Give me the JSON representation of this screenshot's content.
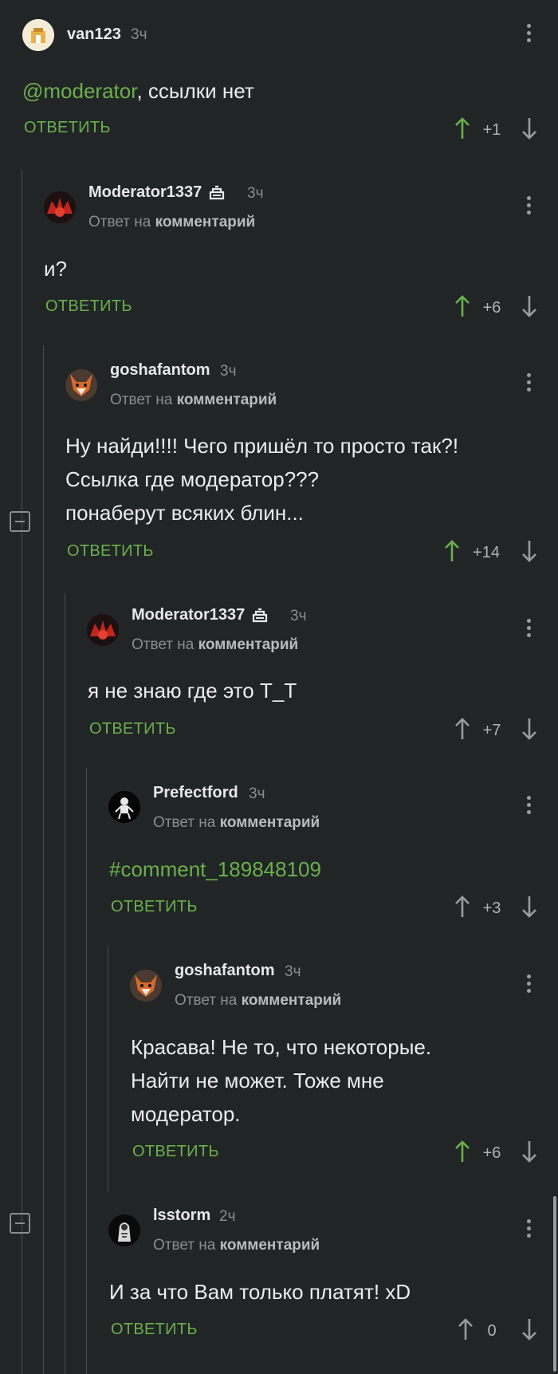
{
  "labels": {
    "reply_to_prefix": "Ответ на",
    "reply_to_target": "комментарий",
    "reply_button": "ОТВЕТИТЬ"
  },
  "colors": {
    "background": "#222526",
    "accent_green": "#6ab04c",
    "muted": "#8a8d8f"
  },
  "comments": [
    {
      "user": "van123",
      "time": "3ч",
      "body_mention": "@moderator",
      "body_text": ",  ссылки нет",
      "score": "+1",
      "upvoted": true
    },
    {
      "user": "Moderator1337",
      "moderator": true,
      "time": "3ч",
      "body_lines": [
        "и?"
      ],
      "score": "+6",
      "upvoted": true
    },
    {
      "user": "goshafantom",
      "time": "3ч",
      "body_lines": [
        "Ну найди!!!! Чего пришёл то просто так?!",
        "Ссылка где модератор???",
        "понаберут всяких блин..."
      ],
      "score": "+14",
      "upvoted": true
    },
    {
      "user": "Moderator1337",
      "moderator": true,
      "time": "3ч",
      "body_lines": [
        "я не знаю где это Т_Т"
      ],
      "score": "+7",
      "upvoted": false
    },
    {
      "user": "Prefectford",
      "time": "3ч",
      "body_link": "#comment_189848109",
      "score": "+3",
      "upvoted": false
    },
    {
      "user": "goshafantom",
      "time": "3ч",
      "body_lines": [
        "Красава! Не то, что некоторые.",
        "Найти не может. Тоже мне",
        "модератор."
      ],
      "score": "+6",
      "upvoted": true
    },
    {
      "user": "lsstorm",
      "time": "2ч",
      "body_lines": [
        "И за что Вам только платят! xD"
      ],
      "score": "0",
      "upvoted": false
    }
  ]
}
